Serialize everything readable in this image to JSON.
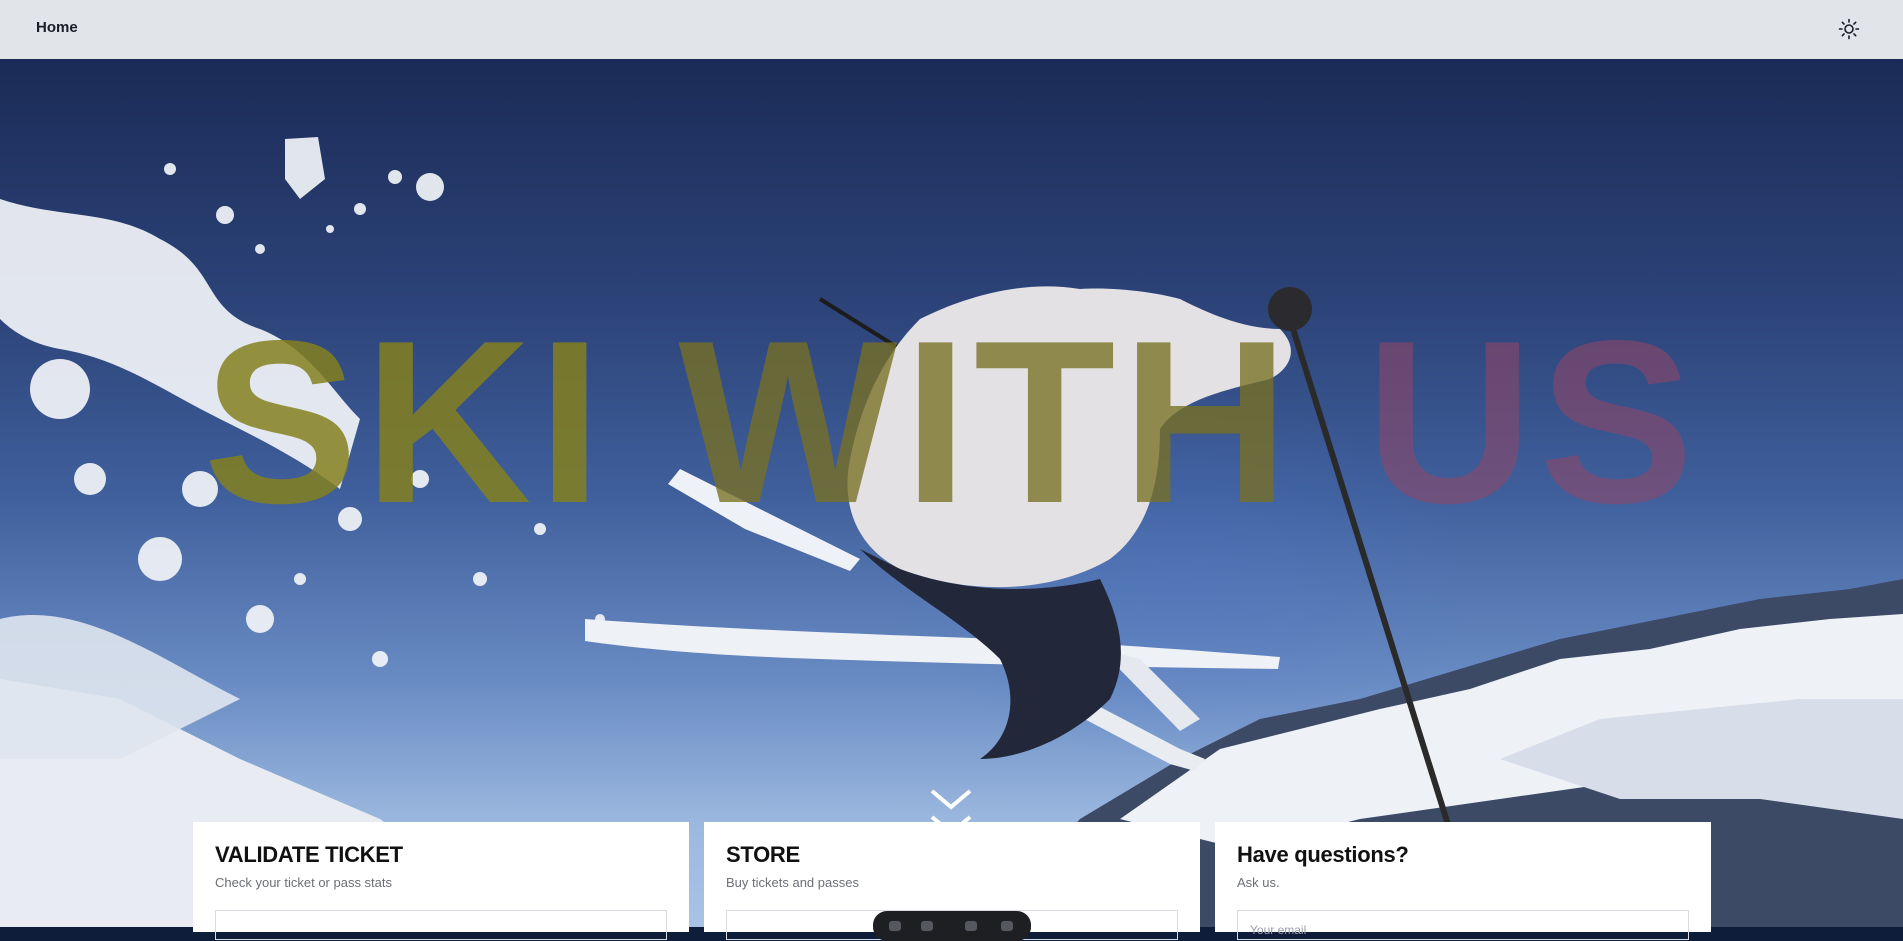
{
  "nav": {
    "home_label": "Home",
    "theme_icon": "sun-icon"
  },
  "hero": {
    "headline_words": [
      "SKI",
      "WITH",
      "US"
    ],
    "scroll_icon": "chevrons-down-icon"
  },
  "cards": [
    {
      "title": "VALIDATE TICKET",
      "subtitle": "Check your ticket or pass stats",
      "field_placeholder": ""
    },
    {
      "title": "STORE",
      "subtitle": "Buy tickets and passes",
      "field_placeholder": ""
    },
    {
      "title": "Have questions?",
      "subtitle": "Ask us.",
      "field_placeholder": "Your email"
    }
  ],
  "colors": {
    "topbar": "#e1e4e9",
    "headline_primary": "#84801e",
    "headline_accent": "#2a10c8",
    "headline_faded": "#96466a"
  }
}
